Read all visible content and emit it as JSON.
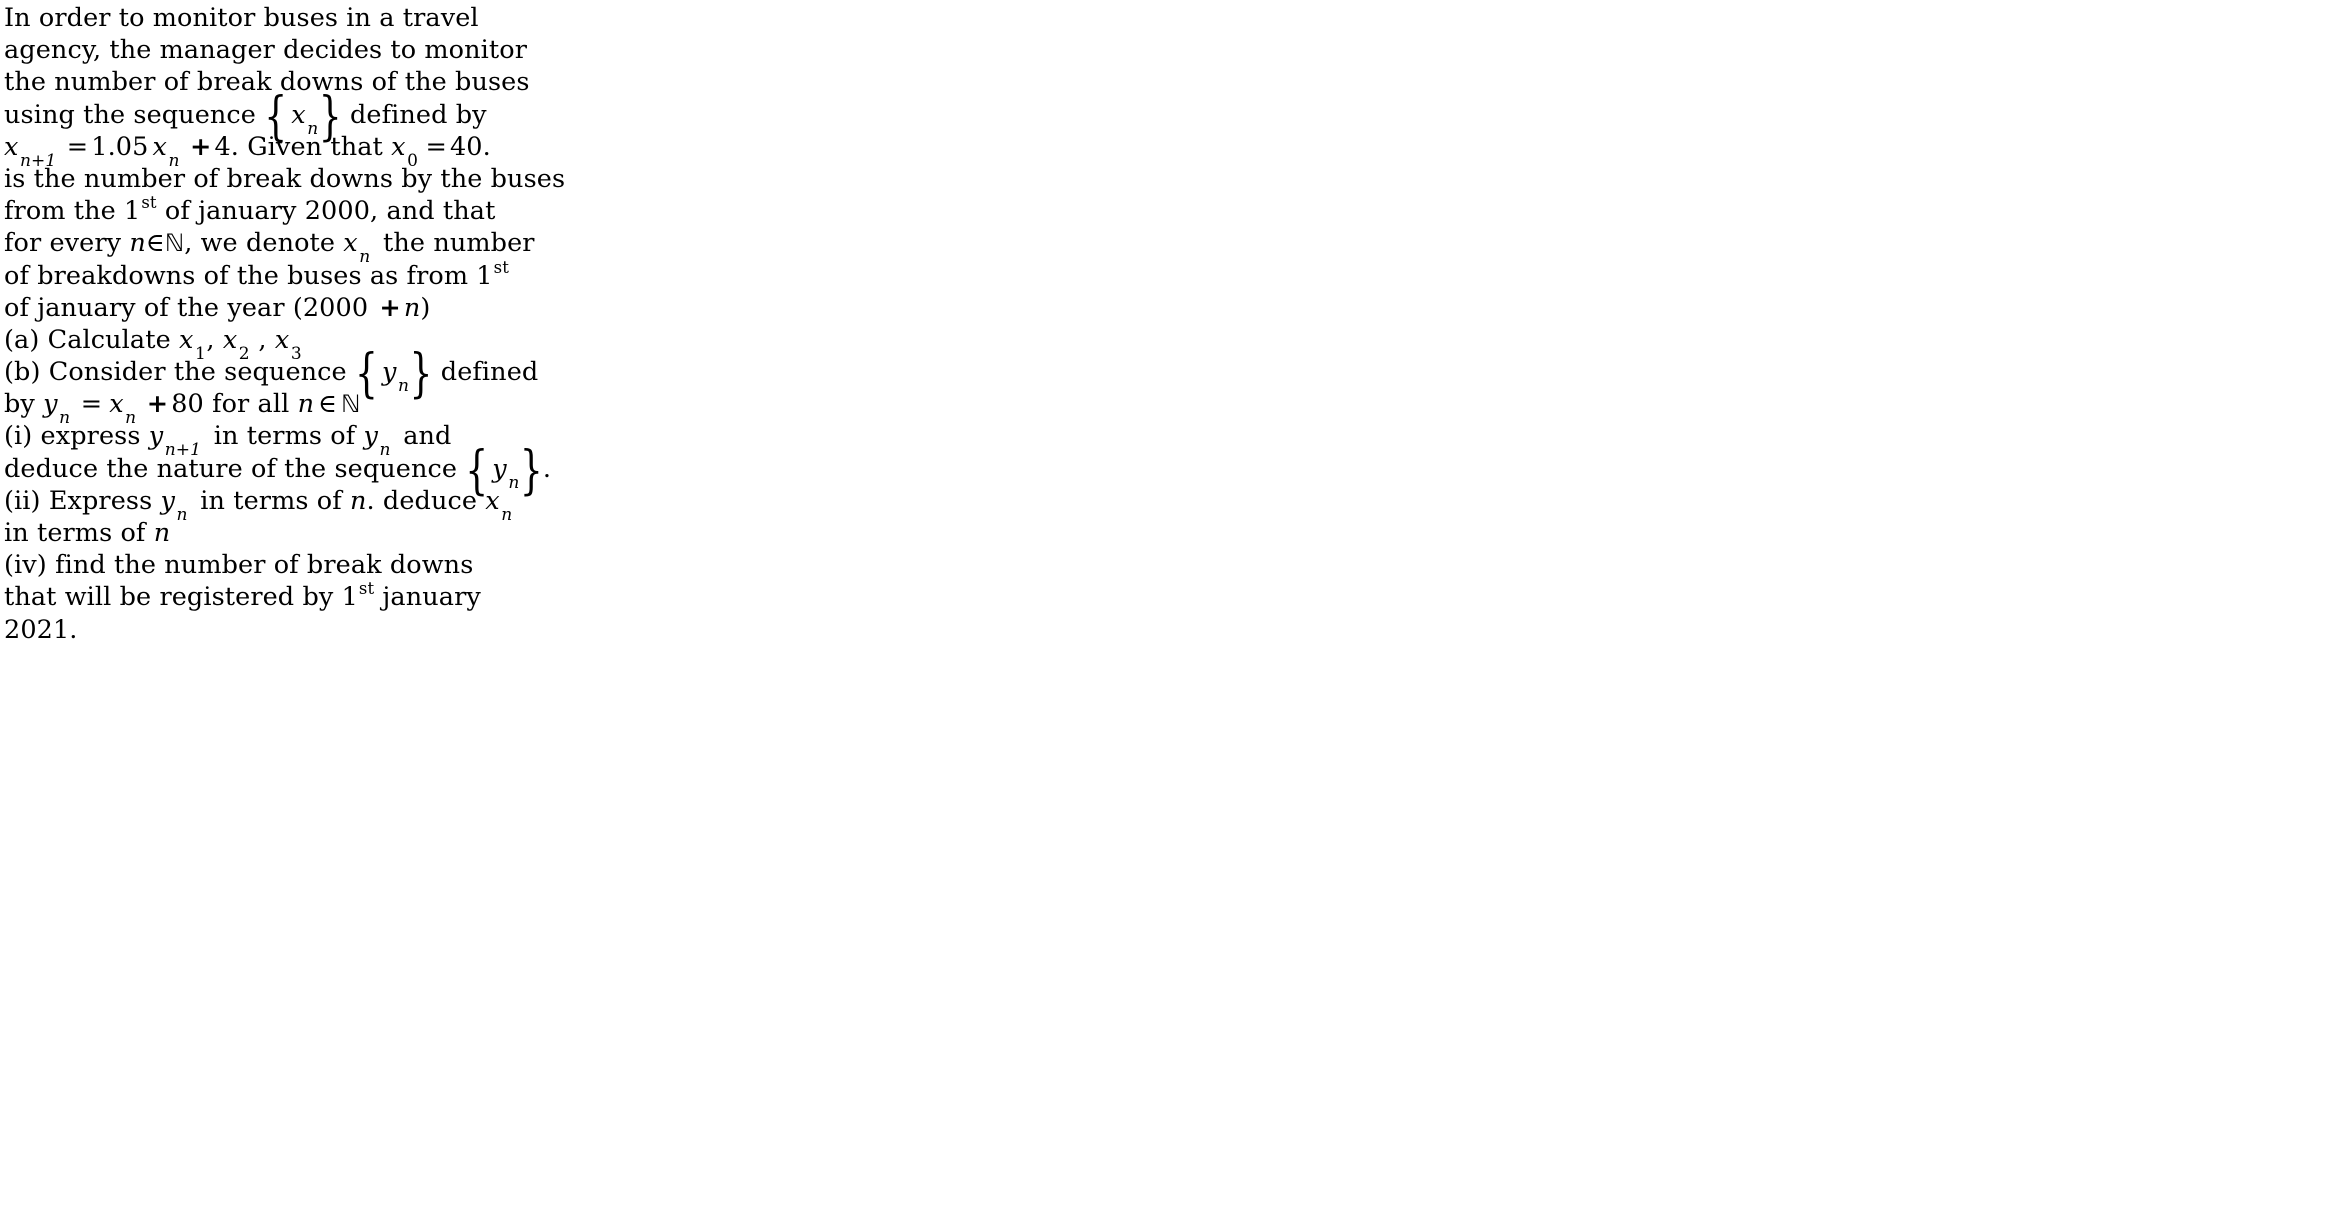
{
  "document": {
    "kind": "math-problem-text",
    "background_color": "#ffffff",
    "text_color": "#000000",
    "lines": [
      {
        "id": "l1",
        "text": "In order to monitor buses in a travel"
      },
      {
        "id": "l2",
        "text": "agency, the manager decides to monitor"
      },
      {
        "id": "l3",
        "text": "the number of break downs of the buses"
      },
      {
        "id": "l4",
        "pre": "using the sequence ",
        "var": "x",
        "sub": "n",
        "post": " defined by"
      },
      {
        "id": "l5",
        "lhs_var": "x",
        "lhs_sub": "n+1",
        "eq": "=",
        "coef": "1.05",
        "rhs_var": "x",
        "rhs_sub": "n",
        "plus": "+",
        "const": "4",
        "tail": ". Given that ",
        "given_var": "x",
        "given_sub": "0",
        "given_eq": "=",
        "given_val": "40."
      },
      {
        "id": "l6",
        "text": "is the number of break downs by the buses"
      },
      {
        "id": "l7",
        "pre": "from the 1",
        "sup": "st",
        "post": " of january 2000, and that"
      },
      {
        "id": "l8",
        "pre": "for every ",
        "var1": "n",
        "member": "∈",
        "set": "ℕ",
        "mid": ", we denote ",
        "var2": "x",
        "sub2": "n",
        "post": " the number"
      },
      {
        "id": "l9",
        "pre": "of breakdowns of the buses as from 1",
        "sup": "st"
      },
      {
        "id": "l10",
        "pre": "of january of the year (2000 ",
        "plus": "+",
        "var": "n",
        "post": ")"
      },
      {
        "id": "l11",
        "pre": "(a) Calculate ",
        "v1": "x",
        "s1": "1",
        "sep1": ", ",
        "v2": "x",
        "s2": "2",
        "sep2": " , ",
        "v3": "x",
        "s3": "3"
      },
      {
        "id": "l12",
        "pre": "(b) Consider the sequence ",
        "var": "y",
        "sub": "n",
        "post": " defined"
      },
      {
        "id": "l13",
        "pre": "by ",
        "v1": "y",
        "s1": "n",
        "eq": "=",
        "v2": "x",
        "s2": "n",
        "plus": "+",
        "num": "80",
        "mid": " for all ",
        "v3": "n",
        "member": "∈",
        "set": "ℕ"
      },
      {
        "id": "l14",
        "pre": "(i) express ",
        "v1": "y",
        "s1": "n+1",
        "mid": " in terms of ",
        "v2": "y",
        "s2": "n",
        "post": " and"
      },
      {
        "id": "l15",
        "pre": "deduce the nature of the sequence ",
        "var": "y",
        "sub": "n",
        "post": "."
      },
      {
        "id": "l16",
        "pre": "(ii) Express ",
        "v1": "y",
        "s1": "n",
        "mid": " in terms of ",
        "v2": "n",
        "mid2": ". deduce ",
        "v3": "x",
        "s3": "n"
      },
      {
        "id": "l17",
        "pre": "in terms of ",
        "var": "n"
      },
      {
        "id": "l18",
        "text": "(iv) find the number of break downs"
      },
      {
        "id": "l19",
        "pre": "that will be registered by 1",
        "sup": "st",
        "post": " january"
      },
      {
        "id": "l20",
        "text": "2021."
      }
    ],
    "symbols": {
      "left_brace": "{",
      "right_brace": "}",
      "element_of": "∈",
      "natural_numbers": "ℕ",
      "equals": "=",
      "plus": "+"
    }
  }
}
